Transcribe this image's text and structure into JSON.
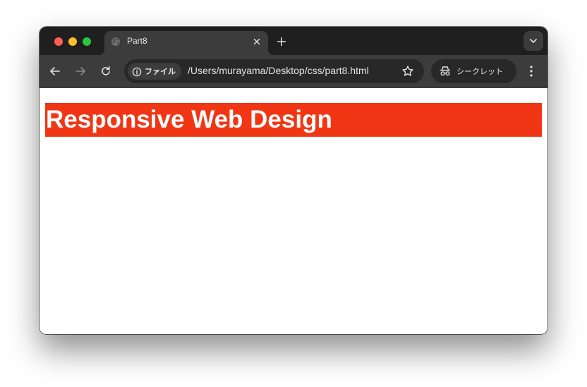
{
  "browser": {
    "tab": {
      "title": "Part8",
      "favicon": "globe-icon"
    },
    "new_tab_icon": "plus-icon",
    "tab_search_icon": "chevron-down-icon",
    "nav": {
      "back_icon": "arrow-left-icon",
      "forward_icon": "arrow-right-icon",
      "reload_icon": "reload-icon"
    },
    "omnibox": {
      "chip_label": "ファイル",
      "chip_icon": "info-icon",
      "url": "/Users/murayama/Desktop/css/part8.html",
      "bookmark_icon": "star-icon"
    },
    "incognito": {
      "label": "シークレット",
      "icon": "incognito-icon"
    },
    "menu_icon": "kebab-menu-icon"
  },
  "page": {
    "heading": "Responsive Web Design",
    "heading_bg": "#f13615",
    "heading_color": "#ffffff"
  }
}
